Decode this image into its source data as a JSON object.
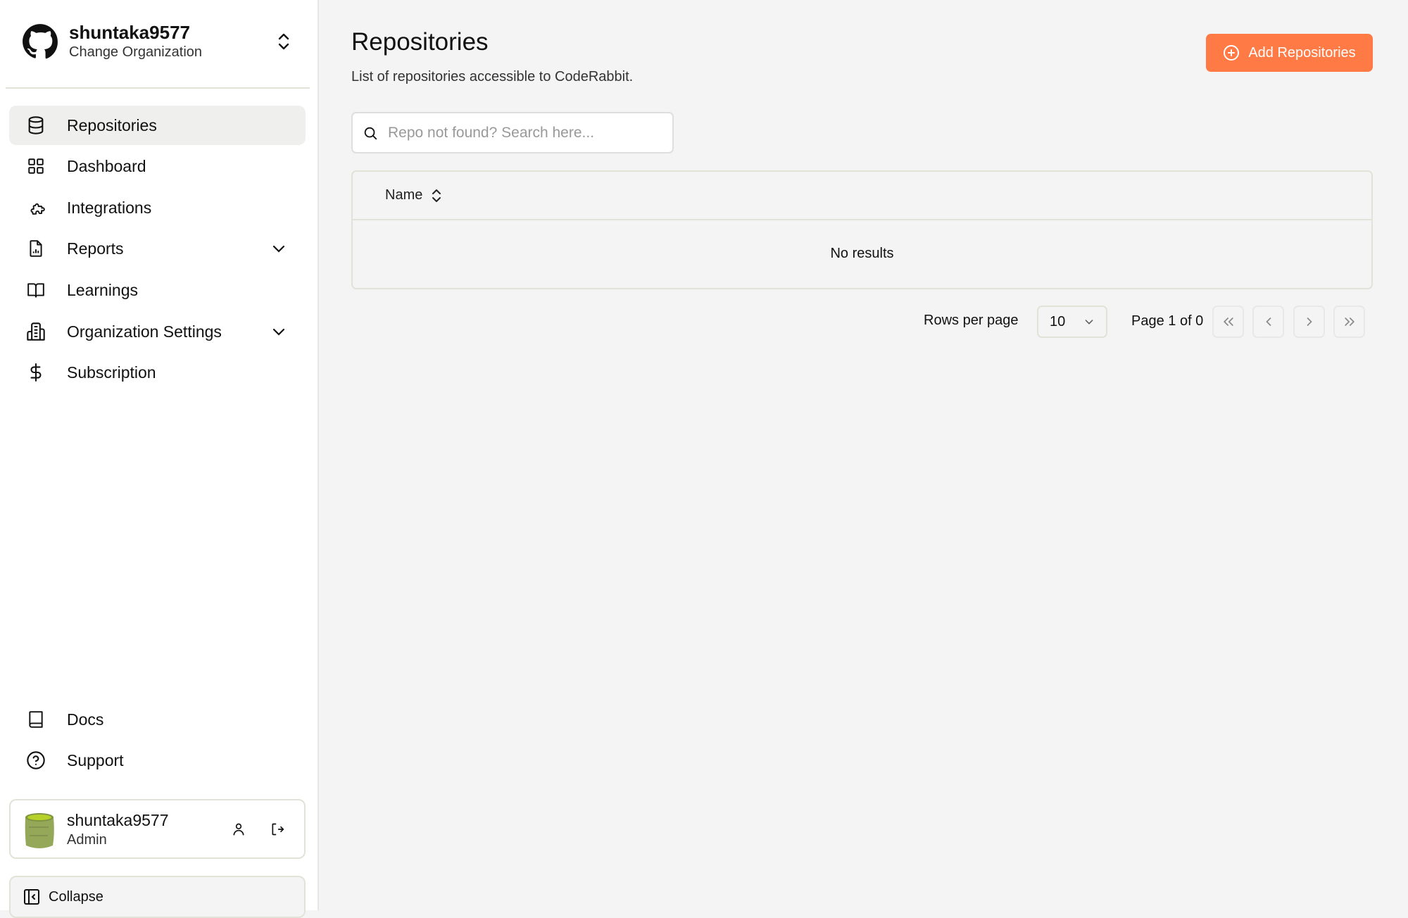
{
  "org": {
    "name": "shuntaka9577",
    "subtitle": "Change Organization"
  },
  "nav": {
    "items": [
      {
        "label": "Repositories",
        "icon": "database-icon",
        "active": true
      },
      {
        "label": "Dashboard",
        "icon": "grid-icon"
      },
      {
        "label": "Integrations",
        "icon": "puzzle-icon"
      },
      {
        "label": "Reports",
        "icon": "file-chart-icon",
        "expandable": true
      },
      {
        "label": "Learnings",
        "icon": "book-open-icon"
      },
      {
        "label": "Organization Settings",
        "icon": "building-icon",
        "expandable": true
      },
      {
        "label": "Subscription",
        "icon": "dollar-icon"
      }
    ],
    "bottom": [
      {
        "label": "Docs",
        "icon": "book-icon"
      },
      {
        "label": "Support",
        "icon": "help-circle-icon"
      }
    ]
  },
  "user": {
    "name": "shuntaka9577",
    "role": "Admin"
  },
  "collapse_label": "Collapse",
  "main": {
    "title": "Repositories",
    "subtitle": "List of repositories accessible to CodeRabbit.",
    "add_button": "Add Repositories",
    "search_placeholder": "Repo not found? Search here...",
    "table": {
      "columns": [
        "Name"
      ],
      "empty_text": "No results"
    },
    "pagination": {
      "rows_label": "Rows per page",
      "rows_value": "10",
      "page_label": "Page 1 of 0"
    }
  },
  "colors": {
    "accent": "#ff7a45",
    "background": "#f4f4f4",
    "sidebar": "#ffffff"
  }
}
